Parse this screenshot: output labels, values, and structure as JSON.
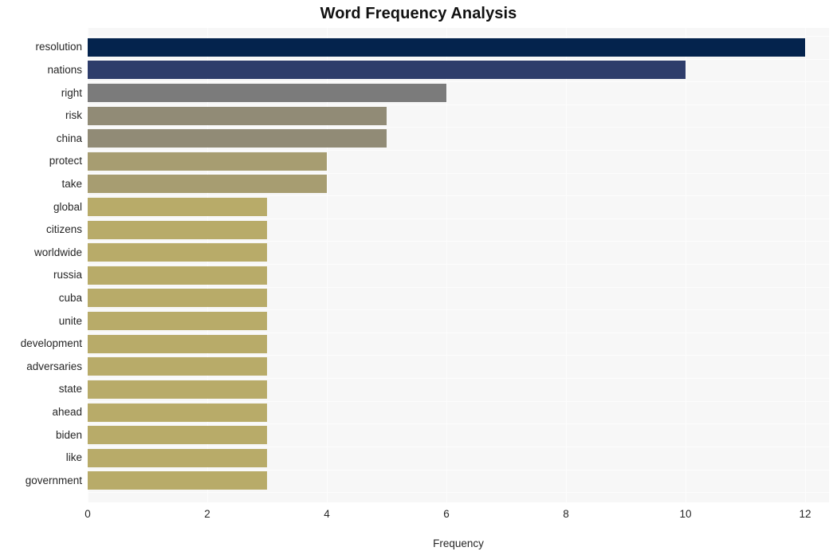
{
  "chart_data": {
    "type": "bar",
    "orientation": "horizontal",
    "title": "Word Frequency Analysis",
    "xlabel": "Frequency",
    "ylabel": "",
    "xlim": [
      0,
      12.4
    ],
    "ylim": null,
    "grid": true,
    "legend": null,
    "xticks": [
      0,
      2,
      4,
      6,
      8,
      10,
      12
    ],
    "xtick_labels": [
      "0",
      "2",
      "4",
      "6",
      "8",
      "10",
      "12"
    ],
    "categories": [
      "resolution",
      "nations",
      "right",
      "risk",
      "china",
      "protect",
      "take",
      "global",
      "citizens",
      "worldwide",
      "russia",
      "cuba",
      "unite",
      "development",
      "adversaries",
      "state",
      "ahead",
      "biden",
      "like",
      "government"
    ],
    "values": [
      12,
      10,
      6,
      5,
      5,
      4,
      4,
      3,
      3,
      3,
      3,
      3,
      3,
      3,
      3,
      3,
      3,
      3,
      3,
      3
    ],
    "bar_colors": [
      "#04234d",
      "#2e3d6b",
      "#7b7b7b",
      "#918b76",
      "#918b76",
      "#a79d71",
      "#a79d71",
      "#b8ab69",
      "#b8ab69",
      "#b8ab69",
      "#b8ab69",
      "#b8ab69",
      "#b8ab69",
      "#b8ab69",
      "#b8ab69",
      "#b8ab69",
      "#b8ab69",
      "#b8ab69",
      "#b8ab69",
      "#b8ab69"
    ],
    "plot_background": "#f7f7f7",
    "figure_background": "#ffffff",
    "gridline_color": "#fdfdfd"
  }
}
